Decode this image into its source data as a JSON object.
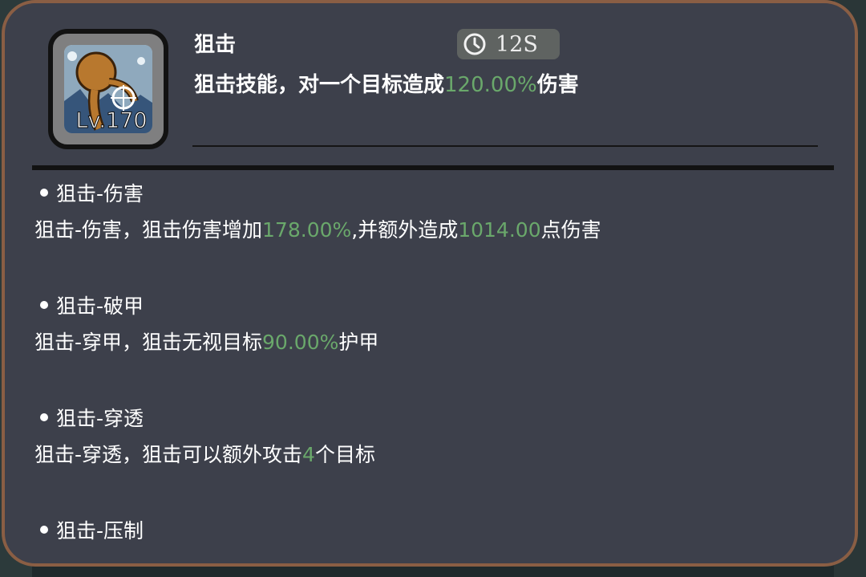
{
  "skill": {
    "name": "狙击",
    "level": "Lv.170",
    "cooldown": "12S",
    "desc_prefix": "狙击技能，对一个目标造成",
    "desc_value": "120.00%",
    "desc_suffix": "伤害"
  },
  "upgrades": [
    {
      "title": "狙击-伤害",
      "desc_parts": [
        {
          "text": "狙击-伤害，狙击伤害增加",
          "highlight": false
        },
        {
          "text": "178.00%",
          "highlight": true
        },
        {
          "text": ",并额外造成",
          "highlight": false
        },
        {
          "text": "1014.00",
          "highlight": true
        },
        {
          "text": "点伤害",
          "highlight": false
        }
      ]
    },
    {
      "title": "狙击-破甲",
      "desc_parts": [
        {
          "text": "狙击-穿甲，狙击无视目标",
          "highlight": false
        },
        {
          "text": "90.00%",
          "highlight": true
        },
        {
          "text": "护甲",
          "highlight": false
        }
      ]
    },
    {
      "title": "狙击-穿透",
      "desc_parts": [
        {
          "text": "狙击-穿透，狙击可以额外攻击",
          "highlight": false
        },
        {
          "text": "4",
          "highlight": true
        },
        {
          "text": "个目标",
          "highlight": false
        }
      ]
    },
    {
      "title": "狙击-压制",
      "desc_parts": []
    }
  ],
  "colors": {
    "panel_bg": "#3d404b",
    "panel_border": "#8a5e44",
    "highlight": "#6aa86b"
  },
  "icons": {
    "skill": "sniper-character-icon",
    "cooldown": "clock-icon"
  }
}
